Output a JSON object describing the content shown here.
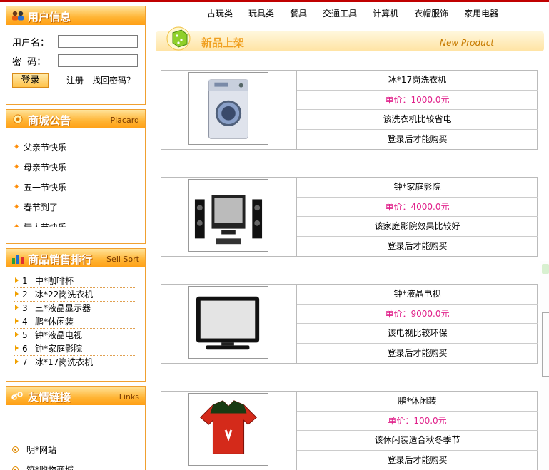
{
  "sidebar": {
    "login": {
      "title": "用户信息",
      "username_label": "用户名：",
      "password_label": "密  码：",
      "login_button": "登录",
      "register_link": "注册",
      "forgot_link": "找回密码？"
    },
    "placard": {
      "title": "商城公告",
      "title_en": "Placard",
      "items": [
        "父亲节快乐",
        "母亲节快乐",
        "五一节快乐",
        "春节到了",
        "情人节快乐"
      ]
    },
    "sellsort": {
      "title": "商品销售排行",
      "title_en": "Sell Sort",
      "items": [
        {
          "rank": "1",
          "name": "中*咖啡杯"
        },
        {
          "rank": "2",
          "name": "冰*22岗洗衣机"
        },
        {
          "rank": "3",
          "name": "三*液晶显示器"
        },
        {
          "rank": "4",
          "name": "鹏*休闲装"
        },
        {
          "rank": "5",
          "name": "钟*液晶电视"
        },
        {
          "rank": "6",
          "name": "钟*家庭影院"
        },
        {
          "rank": "7",
          "name": "冰*17岗洗衣机"
        }
      ]
    },
    "links": {
      "title": "友情链接",
      "title_en": "Links",
      "items": [
        "明*网站",
        "饺*购物商城"
      ]
    }
  },
  "nav": {
    "items": [
      "古玩类",
      "玩具类",
      "餐具",
      "交通工具",
      "计算机",
      "衣帽服饰",
      "家用电器"
    ]
  },
  "banner": {
    "title": "新品上架",
    "title_en": "New Product"
  },
  "products": [
    {
      "name": "冰*17岗洗衣机",
      "price": "单价：1000.0元",
      "desc": "该洗衣机比较省电",
      "action": "登录后才能购买",
      "icon": "washing-machine-icon"
    },
    {
      "name": "钟*家庭影院",
      "price": "单价：4000.0元",
      "desc": "该家庭影院效果比较好",
      "action": "登录后才能购买",
      "icon": "home-theater-icon"
    },
    {
      "name": "钟*液晶电视",
      "price": "单价：9000.0元",
      "desc": "该电视比较环保",
      "action": "登录后才能购买",
      "icon": "lcd-tv-icon"
    },
    {
      "name": "鹏*休闲装",
      "price": "单价：100.0元",
      "desc": "该休闲装适合秋冬季节",
      "action": "登录后才能购买",
      "icon": "polo-shirt-icon"
    }
  ],
  "colors": {
    "accent_orange": "#ffb433",
    "price_pink": "#e0208a",
    "top_line_red": "#c00000"
  }
}
